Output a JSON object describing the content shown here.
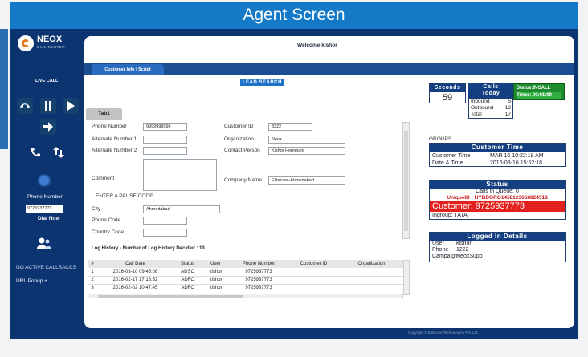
{
  "banner": {
    "title": "Agent Screen"
  },
  "brand": {
    "logo_text": "NEOX",
    "logo_sub": "DIAL CENTER"
  },
  "header": {
    "welcome": "Welcome kishor"
  },
  "tabs": {
    "active": "Customer Info | Script"
  },
  "lead_search": {
    "label": "LEAD SEARCH"
  },
  "sidebar": {
    "live_call": "LIVE CALL",
    "phone_number_label": "Phone Number",
    "phone_number_value": "9725937773",
    "dial_now": "Dial Now",
    "callbacks_link": "NO ACTIVE CALLBACKS",
    "url_popup": "URL Popup +"
  },
  "form": {
    "tab_label": "Tab1",
    "fields": {
      "phone_number": {
        "label": "Phone Number",
        "value": "9999999999"
      },
      "alt_number_1": {
        "label": "Alternate Number 1",
        "value": ""
      },
      "alt_number_2": {
        "label": "Alternate Number 2",
        "value": ""
      },
      "comment": {
        "label": "Comment",
        "value": ""
      },
      "pause_code": {
        "label": "ENTER A PAUSE CODE"
      },
      "city": {
        "label": "City",
        "value": "Ahmedabad"
      },
      "phone_code": {
        "label": "Phone Code",
        "value": ""
      },
      "country_code": {
        "label": "Country Code",
        "value": ""
      },
      "customer_id": {
        "label": "Customer ID",
        "value": "3322"
      },
      "organization": {
        "label": "Organization",
        "value": "Neox"
      },
      "contact_person": {
        "label": "Contact Person",
        "value": "Kishor Hemmani"
      },
      "company_name": {
        "label": "Company Name",
        "value": "Elitecore-Ahmedabad"
      }
    }
  },
  "log_history": {
    "title": "Log History - Number of Log History Decided : 10",
    "columns": [
      "#",
      "Call Date",
      "Status",
      "User",
      "Phone Number",
      "Customer ID",
      "Organization"
    ],
    "rows": [
      [
        "1",
        "2016-03-10 09:45:08",
        "ADSC",
        "kishor",
        "9725937773",
        "",
        ""
      ],
      [
        "2",
        "2016-02-17 17:18:52",
        "ADFC",
        "kishor",
        "9725937773",
        "",
        ""
      ],
      [
        "3",
        "2016-02-02 10:47:45",
        "ADFC",
        "kishor",
        "9725937773",
        "",
        ""
      ]
    ]
  },
  "stats": {
    "seconds_label": "Seconds",
    "seconds_value": "59",
    "calls_today_label": "Calls Today",
    "inbound_label": "Inbound",
    "inbound_value": "5",
    "outbound_label": "Outbound",
    "outbound_value": "12",
    "total_label": "Total",
    "total_value": "17",
    "status_label": "Status:INCALL",
    "timer_label": "Timer: 00:01:09"
  },
  "groups_label": "GROUPS",
  "customer_time": {
    "title": "Customer Time",
    "rows": [
      {
        "label": "Customer Time",
        "value": "MAR 16 10:22:18 AM"
      },
      {
        "label": "Date & Time",
        "value": "2016-03-16 15:52:18"
      }
    ]
  },
  "status_box": {
    "title": "Status",
    "calls_in_queue": "Calls in Queue: 0",
    "unique_id": "UniqueID : HYBDORG1458123668824518",
    "customer": "Customer: 9725937773",
    "ingroup": "Ingroup: TATA"
  },
  "logged_in": {
    "title": "Logged In Details",
    "rows": [
      {
        "label": "User",
        "value": "kishor"
      },
      {
        "label": "Phone",
        "value": "1222"
      },
      {
        "label": "Campaign",
        "value": "NeoxSupp"
      }
    ]
  },
  "footer": {
    "copyright": "Copyright © Elitecore Technologies Pvt. Ltd."
  },
  "colors": {
    "banner": "#1479c6",
    "sidebar": "#0d3570",
    "red": "#e3201c",
    "green": "#1e8b2e",
    "navy": "#143f82"
  }
}
